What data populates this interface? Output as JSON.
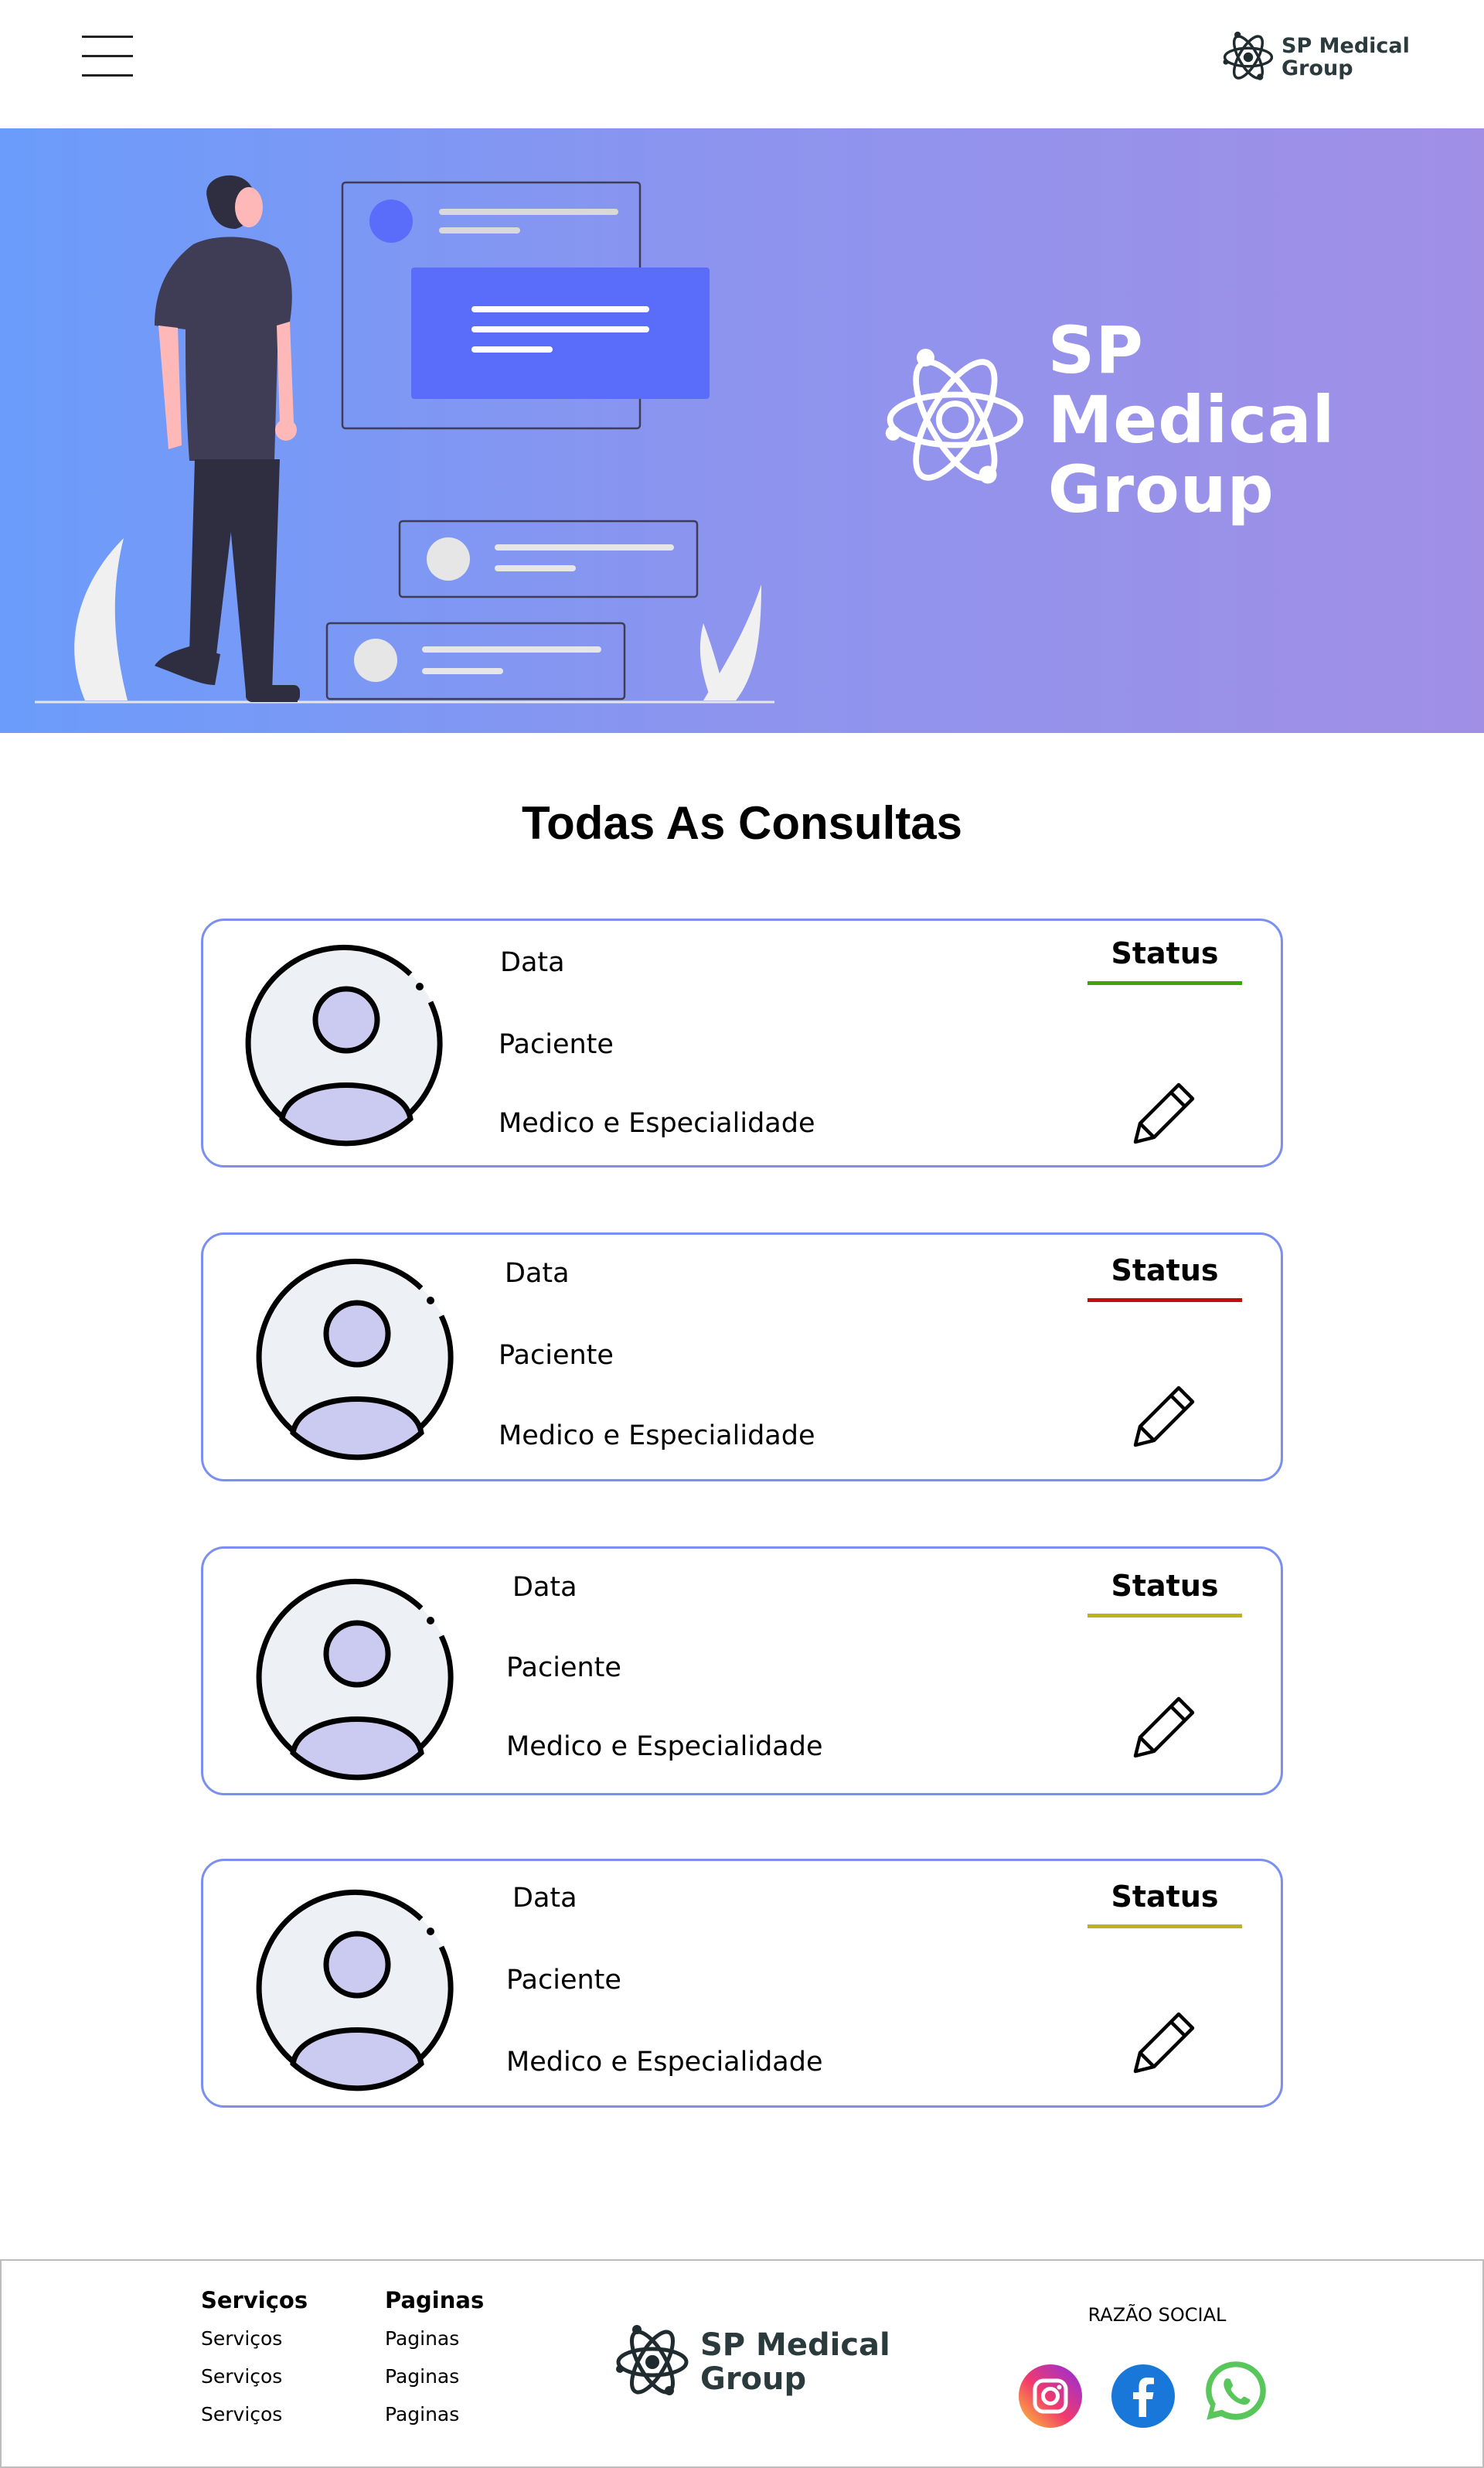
{
  "header": {
    "brand_line1": "SP Medical",
    "brand_line2": "Group"
  },
  "hero": {
    "brand_line1": "SP Medical",
    "brand_line2": "Group"
  },
  "page_title": "Todas As Consultas",
  "consultas": [
    {
      "data_label": "Data",
      "paciente_label": "Paciente",
      "medico_label": "Medico e Especialidade",
      "status_label": "Status",
      "status_color": "#3fa40e"
    },
    {
      "data_label": "Data",
      "paciente_label": "Paciente",
      "medico_label": "Medico e Especialidade",
      "status_label": "Status",
      "status_color": "#c10d0d"
    },
    {
      "data_label": "Data",
      "paciente_label": "Paciente",
      "medico_label": "Medico e Especialidade",
      "status_label": "Status",
      "status_color": "#bcb41c"
    },
    {
      "data_label": "Data",
      "paciente_label": "Paciente",
      "medico_label": "Medico e Especialidade",
      "status_label": "Status",
      "status_color": "#bcb41c"
    }
  ],
  "footer": {
    "servicos": {
      "title": "Serviços",
      "links": [
        "Serviços",
        "Serviços",
        "Serviços"
      ]
    },
    "paginas": {
      "title": "Paginas",
      "links": [
        "Paginas",
        "Paginas",
        "Paginas"
      ]
    },
    "brand_line1": "SP Medical",
    "brand_line2": "Group",
    "razao_social": "RAZÃO SOCIAL",
    "social": [
      "instagram-icon",
      "facebook-icon",
      "whatsapp-icon"
    ]
  },
  "colors": {
    "card_border": "#7b8ff0",
    "hero_start": "#6b9cfb",
    "hero_end": "#a18fe6",
    "brand_dark": "#2b3a3d"
  }
}
